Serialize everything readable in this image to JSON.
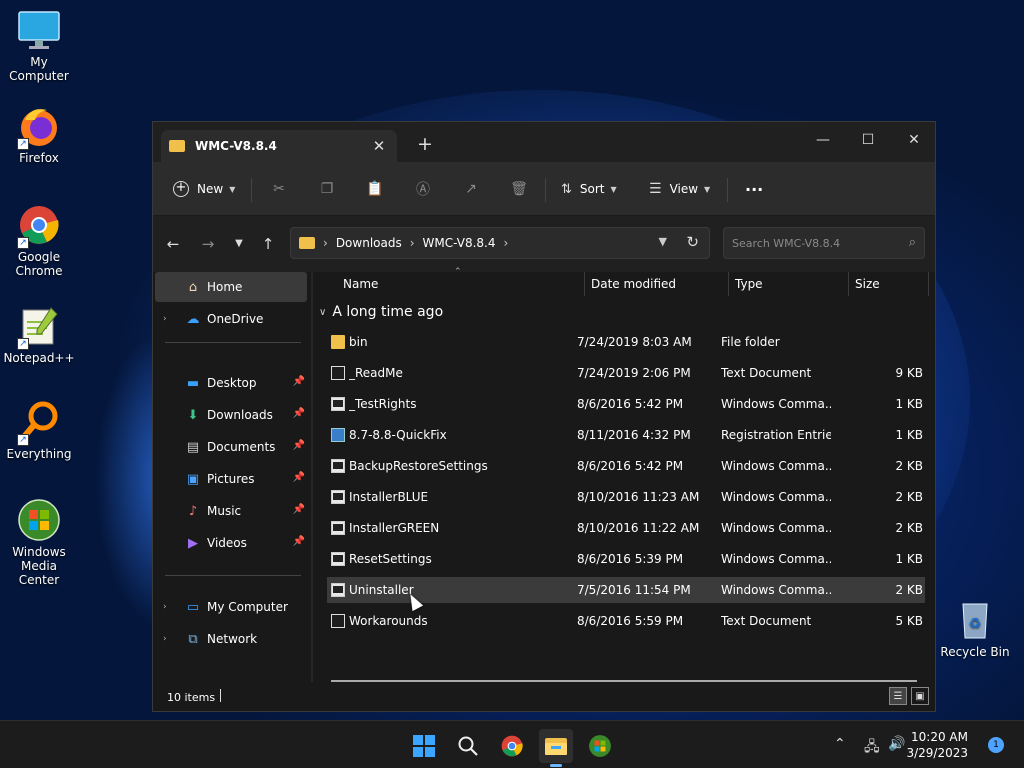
{
  "desktop": {
    "icons": [
      {
        "label": "My Computer"
      },
      {
        "label": "Firefox"
      },
      {
        "label": "Google Chrome"
      },
      {
        "label": "Notepad++"
      },
      {
        "label": "Everything"
      },
      {
        "label": "Windows Media Center"
      },
      {
        "label": "Recycle Bin"
      }
    ]
  },
  "window": {
    "tab_title": "WMC-V8.8.4",
    "toolbar": {
      "new_label": "New",
      "sort_label": "Sort",
      "view_label": "View",
      "more_label": "···"
    },
    "breadcrumb": [
      "Downloads",
      "WMC-V8.8.4"
    ],
    "search_placeholder": "Search WMC-V8.8.4",
    "sidebar": {
      "home": "Home",
      "onedrive": "OneDrive",
      "quick": [
        "Desktop",
        "Downloads",
        "Documents",
        "Pictures",
        "Music",
        "Videos"
      ],
      "my_computer": "My Computer",
      "network": "Network"
    },
    "columns": {
      "name": "Name",
      "date": "Date modified",
      "type": "Type",
      "size": "Size"
    },
    "group_label": "A long time ago",
    "files": [
      {
        "name": "bin",
        "date": "7/24/2019 8:03 AM",
        "type": "File folder",
        "size": "",
        "icon": "folder-icon"
      },
      {
        "name": "_ReadMe",
        "date": "7/24/2019 2:06 PM",
        "type": "Text Document",
        "size": "9 KB",
        "icon": "text-file-icon"
      },
      {
        "name": "_TestRights",
        "date": "8/6/2016 5:42 PM",
        "type": "Windows Comma...",
        "size": "1 KB",
        "icon": "cmd-file-icon"
      },
      {
        "name": "8.7-8.8-QuickFix",
        "date": "8/11/2016 4:32 PM",
        "type": "Registration Entries",
        "size": "1 KB",
        "icon": "registry-file-icon"
      },
      {
        "name": "BackupRestoreSettings",
        "date": "8/6/2016 5:42 PM",
        "type": "Windows Comma...",
        "size": "2 KB",
        "icon": "cmd-file-icon"
      },
      {
        "name": "InstallerBLUE",
        "date": "8/10/2016 11:23 AM",
        "type": "Windows Comma...",
        "size": "2 KB",
        "icon": "cmd-file-icon"
      },
      {
        "name": "InstallerGREEN",
        "date": "8/10/2016 11:22 AM",
        "type": "Windows Comma...",
        "size": "2 KB",
        "icon": "cmd-file-icon"
      },
      {
        "name": "ResetSettings",
        "date": "8/6/2016 5:39 PM",
        "type": "Windows Comma...",
        "size": "1 KB",
        "icon": "cmd-file-icon"
      },
      {
        "name": "Uninstaller",
        "date": "7/5/2016 11:54 PM",
        "type": "Windows Comma...",
        "size": "2 KB",
        "icon": "cmd-file-icon"
      },
      {
        "name": "Workarounds",
        "date": "8/6/2016 5:59 PM",
        "type": "Text Document",
        "size": "5 KB",
        "icon": "text-file-icon"
      }
    ],
    "status": "10 items"
  },
  "taskbar": {
    "time": "10:20 AM",
    "date": "3/29/2023",
    "notification_count": "1"
  },
  "colors": {
    "accent": "#4ea3ff",
    "window_bg": "#191919",
    "toolbar_bg": "#2c2c2c",
    "folder": "#f0c04a"
  }
}
